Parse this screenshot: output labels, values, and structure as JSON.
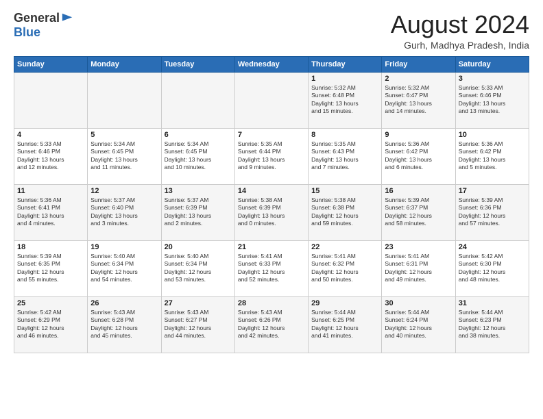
{
  "logo": {
    "general": "General",
    "blue": "Blue"
  },
  "title": "August 2024",
  "location": "Gurh, Madhya Pradesh, India",
  "days_of_week": [
    "Sunday",
    "Monday",
    "Tuesday",
    "Wednesday",
    "Thursday",
    "Friday",
    "Saturday"
  ],
  "weeks": [
    [
      {
        "day": "",
        "info": ""
      },
      {
        "day": "",
        "info": ""
      },
      {
        "day": "",
        "info": ""
      },
      {
        "day": "",
        "info": ""
      },
      {
        "day": "1",
        "info": "Sunrise: 5:32 AM\nSunset: 6:48 PM\nDaylight: 13 hours\nand 15 minutes."
      },
      {
        "day": "2",
        "info": "Sunrise: 5:32 AM\nSunset: 6:47 PM\nDaylight: 13 hours\nand 14 minutes."
      },
      {
        "day": "3",
        "info": "Sunrise: 5:33 AM\nSunset: 6:46 PM\nDaylight: 13 hours\nand 13 minutes."
      }
    ],
    [
      {
        "day": "4",
        "info": "Sunrise: 5:33 AM\nSunset: 6:46 PM\nDaylight: 13 hours\nand 12 minutes."
      },
      {
        "day": "5",
        "info": "Sunrise: 5:34 AM\nSunset: 6:45 PM\nDaylight: 13 hours\nand 11 minutes."
      },
      {
        "day": "6",
        "info": "Sunrise: 5:34 AM\nSunset: 6:45 PM\nDaylight: 13 hours\nand 10 minutes."
      },
      {
        "day": "7",
        "info": "Sunrise: 5:35 AM\nSunset: 6:44 PM\nDaylight: 13 hours\nand 9 minutes."
      },
      {
        "day": "8",
        "info": "Sunrise: 5:35 AM\nSunset: 6:43 PM\nDaylight: 13 hours\nand 7 minutes."
      },
      {
        "day": "9",
        "info": "Sunrise: 5:36 AM\nSunset: 6:42 PM\nDaylight: 13 hours\nand 6 minutes."
      },
      {
        "day": "10",
        "info": "Sunrise: 5:36 AM\nSunset: 6:42 PM\nDaylight: 13 hours\nand 5 minutes."
      }
    ],
    [
      {
        "day": "11",
        "info": "Sunrise: 5:36 AM\nSunset: 6:41 PM\nDaylight: 13 hours\nand 4 minutes."
      },
      {
        "day": "12",
        "info": "Sunrise: 5:37 AM\nSunset: 6:40 PM\nDaylight: 13 hours\nand 3 minutes."
      },
      {
        "day": "13",
        "info": "Sunrise: 5:37 AM\nSunset: 6:39 PM\nDaylight: 13 hours\nand 2 minutes."
      },
      {
        "day": "14",
        "info": "Sunrise: 5:38 AM\nSunset: 6:39 PM\nDaylight: 13 hours\nand 0 minutes."
      },
      {
        "day": "15",
        "info": "Sunrise: 5:38 AM\nSunset: 6:38 PM\nDaylight: 12 hours\nand 59 minutes."
      },
      {
        "day": "16",
        "info": "Sunrise: 5:39 AM\nSunset: 6:37 PM\nDaylight: 12 hours\nand 58 minutes."
      },
      {
        "day": "17",
        "info": "Sunrise: 5:39 AM\nSunset: 6:36 PM\nDaylight: 12 hours\nand 57 minutes."
      }
    ],
    [
      {
        "day": "18",
        "info": "Sunrise: 5:39 AM\nSunset: 6:35 PM\nDaylight: 12 hours\nand 55 minutes."
      },
      {
        "day": "19",
        "info": "Sunrise: 5:40 AM\nSunset: 6:34 PM\nDaylight: 12 hours\nand 54 minutes."
      },
      {
        "day": "20",
        "info": "Sunrise: 5:40 AM\nSunset: 6:34 PM\nDaylight: 12 hours\nand 53 minutes."
      },
      {
        "day": "21",
        "info": "Sunrise: 5:41 AM\nSunset: 6:33 PM\nDaylight: 12 hours\nand 52 minutes."
      },
      {
        "day": "22",
        "info": "Sunrise: 5:41 AM\nSunset: 6:32 PM\nDaylight: 12 hours\nand 50 minutes."
      },
      {
        "day": "23",
        "info": "Sunrise: 5:41 AM\nSunset: 6:31 PM\nDaylight: 12 hours\nand 49 minutes."
      },
      {
        "day": "24",
        "info": "Sunrise: 5:42 AM\nSunset: 6:30 PM\nDaylight: 12 hours\nand 48 minutes."
      }
    ],
    [
      {
        "day": "25",
        "info": "Sunrise: 5:42 AM\nSunset: 6:29 PM\nDaylight: 12 hours\nand 46 minutes."
      },
      {
        "day": "26",
        "info": "Sunrise: 5:43 AM\nSunset: 6:28 PM\nDaylight: 12 hours\nand 45 minutes."
      },
      {
        "day": "27",
        "info": "Sunrise: 5:43 AM\nSunset: 6:27 PM\nDaylight: 12 hours\nand 44 minutes."
      },
      {
        "day": "28",
        "info": "Sunrise: 5:43 AM\nSunset: 6:26 PM\nDaylight: 12 hours\nand 42 minutes."
      },
      {
        "day": "29",
        "info": "Sunrise: 5:44 AM\nSunset: 6:25 PM\nDaylight: 12 hours\nand 41 minutes."
      },
      {
        "day": "30",
        "info": "Sunrise: 5:44 AM\nSunset: 6:24 PM\nDaylight: 12 hours\nand 40 minutes."
      },
      {
        "day": "31",
        "info": "Sunrise: 5:44 AM\nSunset: 6:23 PM\nDaylight: 12 hours\nand 38 minutes."
      }
    ]
  ]
}
